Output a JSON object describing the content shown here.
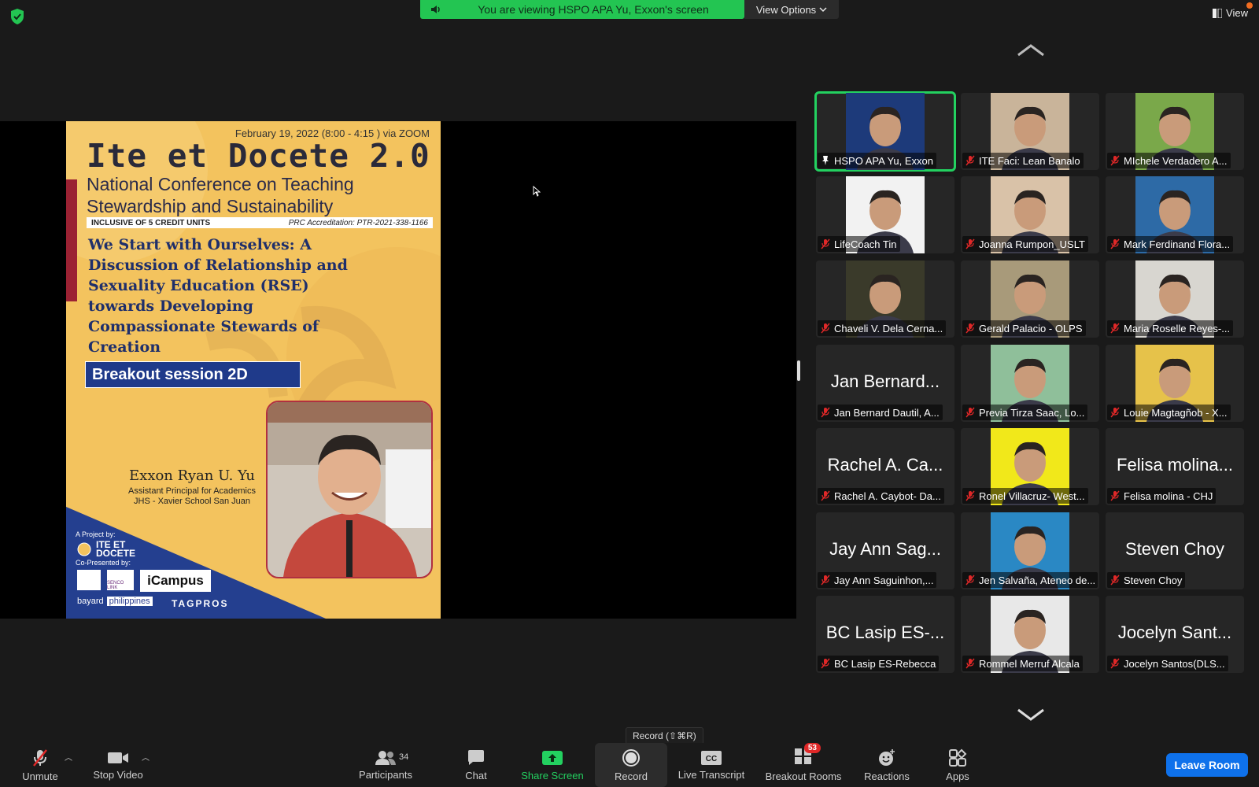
{
  "banner": {
    "text": "You are viewing HSPO APA Yu, Exxon's screen",
    "view_options": "View Options"
  },
  "view_button": "View",
  "poster": {
    "date": "February 19, 2022 (8:00 - 4:15 ) via ZOOM",
    "title": "Ite et Docete 2.0",
    "subtitle": "National Conference on Teaching Stewardship and Sustainability",
    "credit": "INCLUSIVE OF 5 CREDIT UNITS",
    "accreditation": "PRC Accreditation: PTR-2021-338-1166",
    "topic": "We Start with Ourselves: A Discussion of Relationship and Sexuality Education (RSE) towards Developing Compassionate Stewards of Creation",
    "session": "Breakout session 2D",
    "speaker_name": "Exxon Ryan U. Yu",
    "speaker_role_1": "Assistant Principal for Academics",
    "speaker_role_2": "JHS - Xavier School San Juan",
    "project_by": "A Project by:",
    "ite_logo_1": "ITE ET",
    "ite_logo_2": "DOCETE",
    "co_presented": "Co-Presented by:",
    "senco": "SENCO LINK",
    "icampus": "iCampus",
    "bayard": "bayard",
    "philippines": "philippines",
    "tagpros": "TAGPROS"
  },
  "participants_grid": [
    {
      "name": "HSPO APA Yu, Exxon",
      "big": "",
      "pinned": true,
      "active": true,
      "video": true,
      "bg": "#1d3a7a"
    },
    {
      "name": "ITE Faci: Lean Banalo",
      "big": "",
      "video": true,
      "bg": "#c9b49a"
    },
    {
      "name": "MIchele Verdadero A...",
      "big": "",
      "video": true,
      "bg": "#7aa84a"
    },
    {
      "name": "LifeCoach Tin",
      "big": "",
      "video": true,
      "bg": "#f2f2f2"
    },
    {
      "name": "Joanna Rumpon_USLT",
      "big": "",
      "video": true,
      "bg": "#d9c2a8"
    },
    {
      "name": "Mark Ferdinand Flora...",
      "big": "",
      "video": true,
      "bg": "#2d6aa6"
    },
    {
      "name": "Chaveli V. Dela Cerna...",
      "big": "",
      "video": true,
      "bg": "#3a3a2a"
    },
    {
      "name": "Gerald Palacio - OLPS",
      "big": "",
      "video": true,
      "bg": "#a89a7a"
    },
    {
      "name": "Maria Roselle Reyes-...",
      "big": "",
      "video": true,
      "bg": "#d8d6d0"
    },
    {
      "name": "Jan Bernard Dautil, A...",
      "big": "Jan Bernard...",
      "video": false
    },
    {
      "name": "Previa Tirza Saac, Lo...",
      "big": "",
      "video": true,
      "bg": "#8fbf9a"
    },
    {
      "name": "Louie Magtagñob - X...",
      "big": "",
      "video": true,
      "bg": "#e6c24a"
    },
    {
      "name": "Rachel A. Caybot- Da...",
      "big": "Rachel A. Ca...",
      "video": false
    },
    {
      "name": "Ronel Villacruz- West...",
      "big": "",
      "video": true,
      "bg": "#f1e81a"
    },
    {
      "name": "Felisa molina - CHJ",
      "big": "Felisa molina...",
      "video": false
    },
    {
      "name": "Jay Ann Saguinhon,...",
      "big": "Jay Ann Sag...",
      "video": false
    },
    {
      "name": "Jen Salvaña, Ateneo de...",
      "big": "",
      "video": true,
      "bg": "#2a88c4"
    },
    {
      "name": "Steven Choy",
      "big": "Steven Choy",
      "video": false
    },
    {
      "name": "BC Lasip ES-Rebecca",
      "big": "BC Lasip ES-...",
      "video": false
    },
    {
      "name": "Rommel Merruf Alcala",
      "big": "",
      "video": true,
      "bg": "#e8e8e8"
    },
    {
      "name": "Jocelyn Santos(DLS...",
      "big": "Jocelyn Sant...",
      "video": false
    }
  ],
  "tooltip": "Record (⇧⌘R)",
  "toolbar": {
    "unmute": "Unmute",
    "stop_video": "Stop Video",
    "participants": "Participants",
    "participants_count": "34",
    "chat": "Chat",
    "share_screen": "Share Screen",
    "record": "Record",
    "live_transcript": "Live Transcript",
    "breakout_rooms": "Breakout Rooms",
    "breakout_badge": "53",
    "reactions": "Reactions",
    "apps": "Apps",
    "leave_room": "Leave Room"
  },
  "colors": {
    "accent_green": "#23d160",
    "leave_blue": "#0e71eb",
    "badge_red": "#e02828"
  }
}
